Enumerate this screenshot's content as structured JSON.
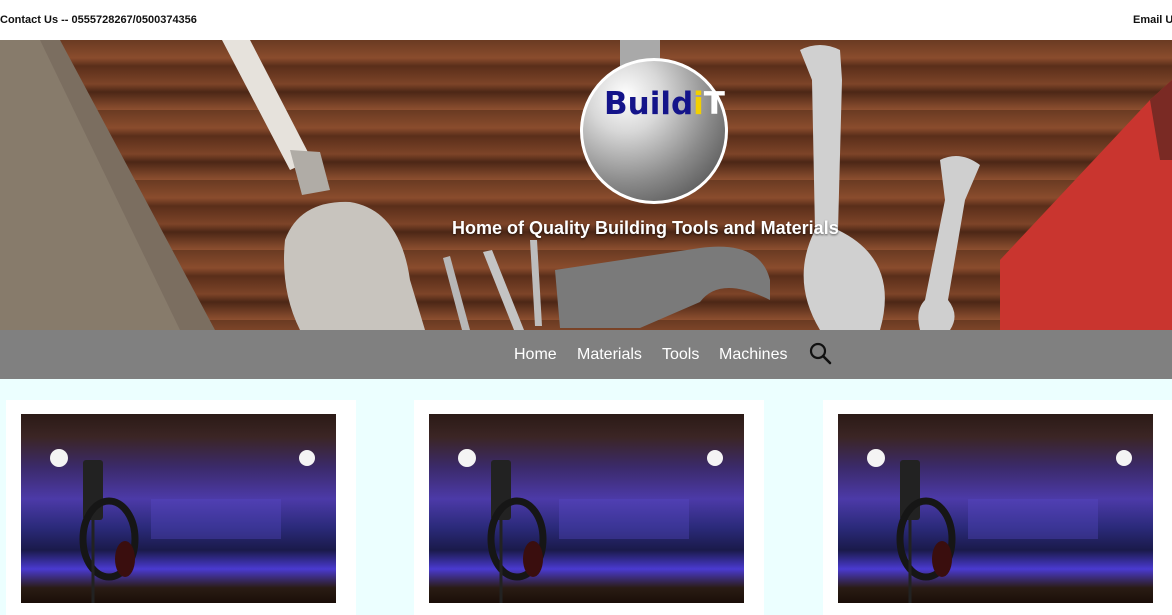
{
  "topbar": {
    "contact": "Contact Us -- 0555728267/0500374356",
    "email": "Email U"
  },
  "hero": {
    "logo": {
      "part1": "Build",
      "part2": "i",
      "part3": "T"
    },
    "tagline": "Home of Quality Building Tools and Materials"
  },
  "nav": {
    "items": [
      "Home",
      "Materials",
      "Tools",
      "Machines"
    ],
    "search_icon": "search-icon"
  },
  "cards": [
    {
      "image": "studio-microphone-headphones"
    },
    {
      "image": "studio-microphone-headphones"
    },
    {
      "image": "studio-microphone-headphones"
    }
  ],
  "colors": {
    "nav_bg": "#808080",
    "content_bg": "#ecffff",
    "logo_blue": "#14148a",
    "logo_yellow": "#f2d000"
  }
}
